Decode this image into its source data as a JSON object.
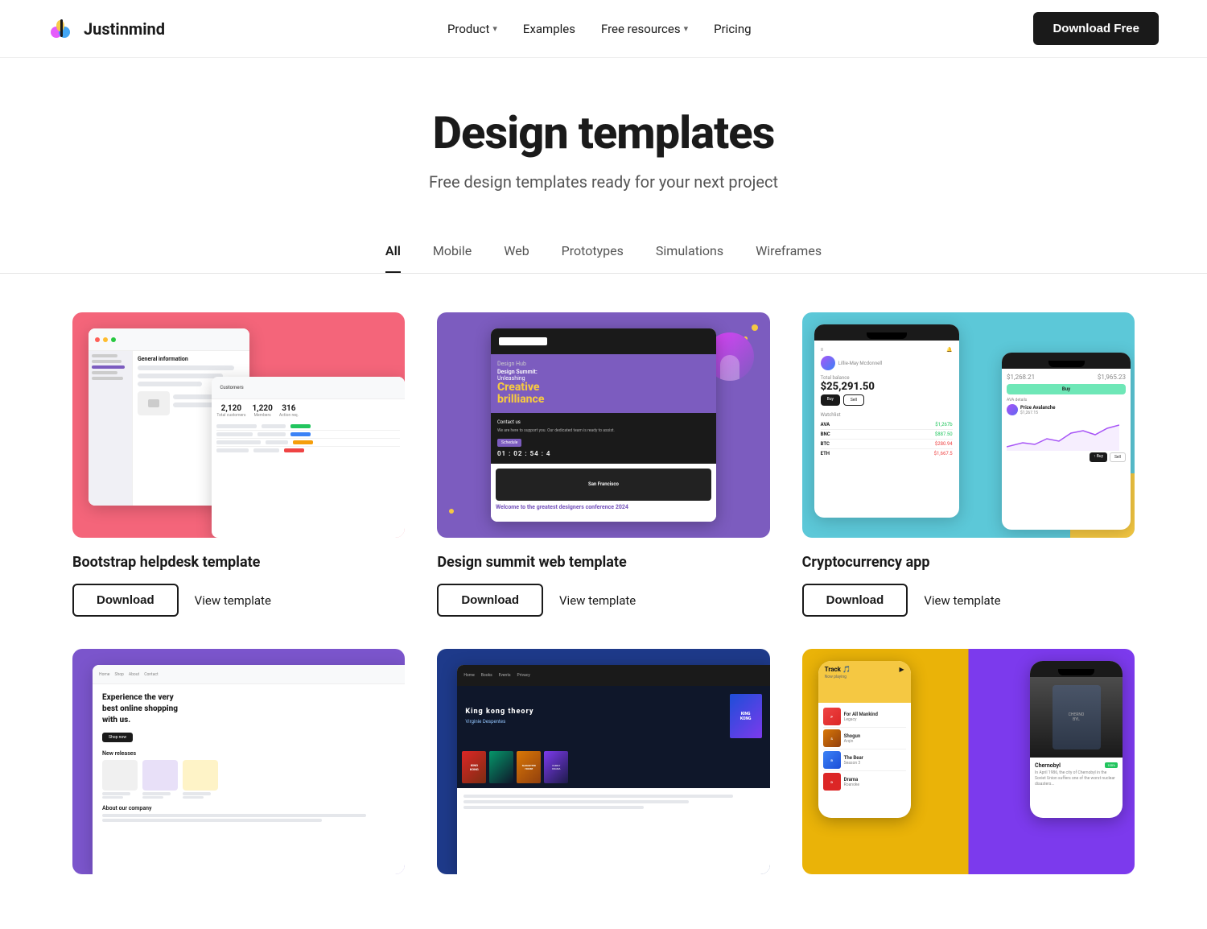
{
  "nav": {
    "logo_text": "Justinmind",
    "links": [
      {
        "label": "Product",
        "has_dropdown": true
      },
      {
        "label": "Examples",
        "has_dropdown": false
      },
      {
        "label": "Free resources",
        "has_dropdown": true
      },
      {
        "label": "Pricing",
        "has_dropdown": false
      }
    ],
    "cta_label": "Download Free"
  },
  "hero": {
    "title": "Design templates",
    "subtitle": "Free design templates ready for your next project"
  },
  "tabs": [
    {
      "label": "All",
      "active": true
    },
    {
      "label": "Mobile",
      "active": false
    },
    {
      "label": "Web",
      "active": false
    },
    {
      "label": "Prototypes",
      "active": false
    },
    {
      "label": "Simulations",
      "active": false
    },
    {
      "label": "Wireframes",
      "active": false
    }
  ],
  "templates": [
    {
      "id": "bootstrap-helpdesk",
      "title": "Bootstrap helpdesk template",
      "download_label": "Download",
      "view_label": "View template",
      "bg_class": "card1-bg"
    },
    {
      "id": "design-summit",
      "title": "Design summit web template",
      "download_label": "Download",
      "view_label": "View template",
      "bg_class": "card2-bg"
    },
    {
      "id": "cryptocurrency-app",
      "title": "Cryptocurrency app",
      "download_label": "Download",
      "view_label": "View template",
      "bg_class": "card3-bg"
    }
  ],
  "bottom_templates": [
    {
      "id": "ecommerce",
      "bg_class": "card4-bg"
    },
    {
      "id": "book-web",
      "bg_class": "card5-bg"
    },
    {
      "id": "music-app",
      "bg_class": "card6-bg"
    }
  ],
  "colors": {
    "pink": "#f4657a",
    "purple": "#7c5cbf",
    "cyan": "#5cc8d8",
    "violet": "#7b55cc",
    "blue": "#1e3a8a",
    "dark": "#1a1a1a"
  }
}
